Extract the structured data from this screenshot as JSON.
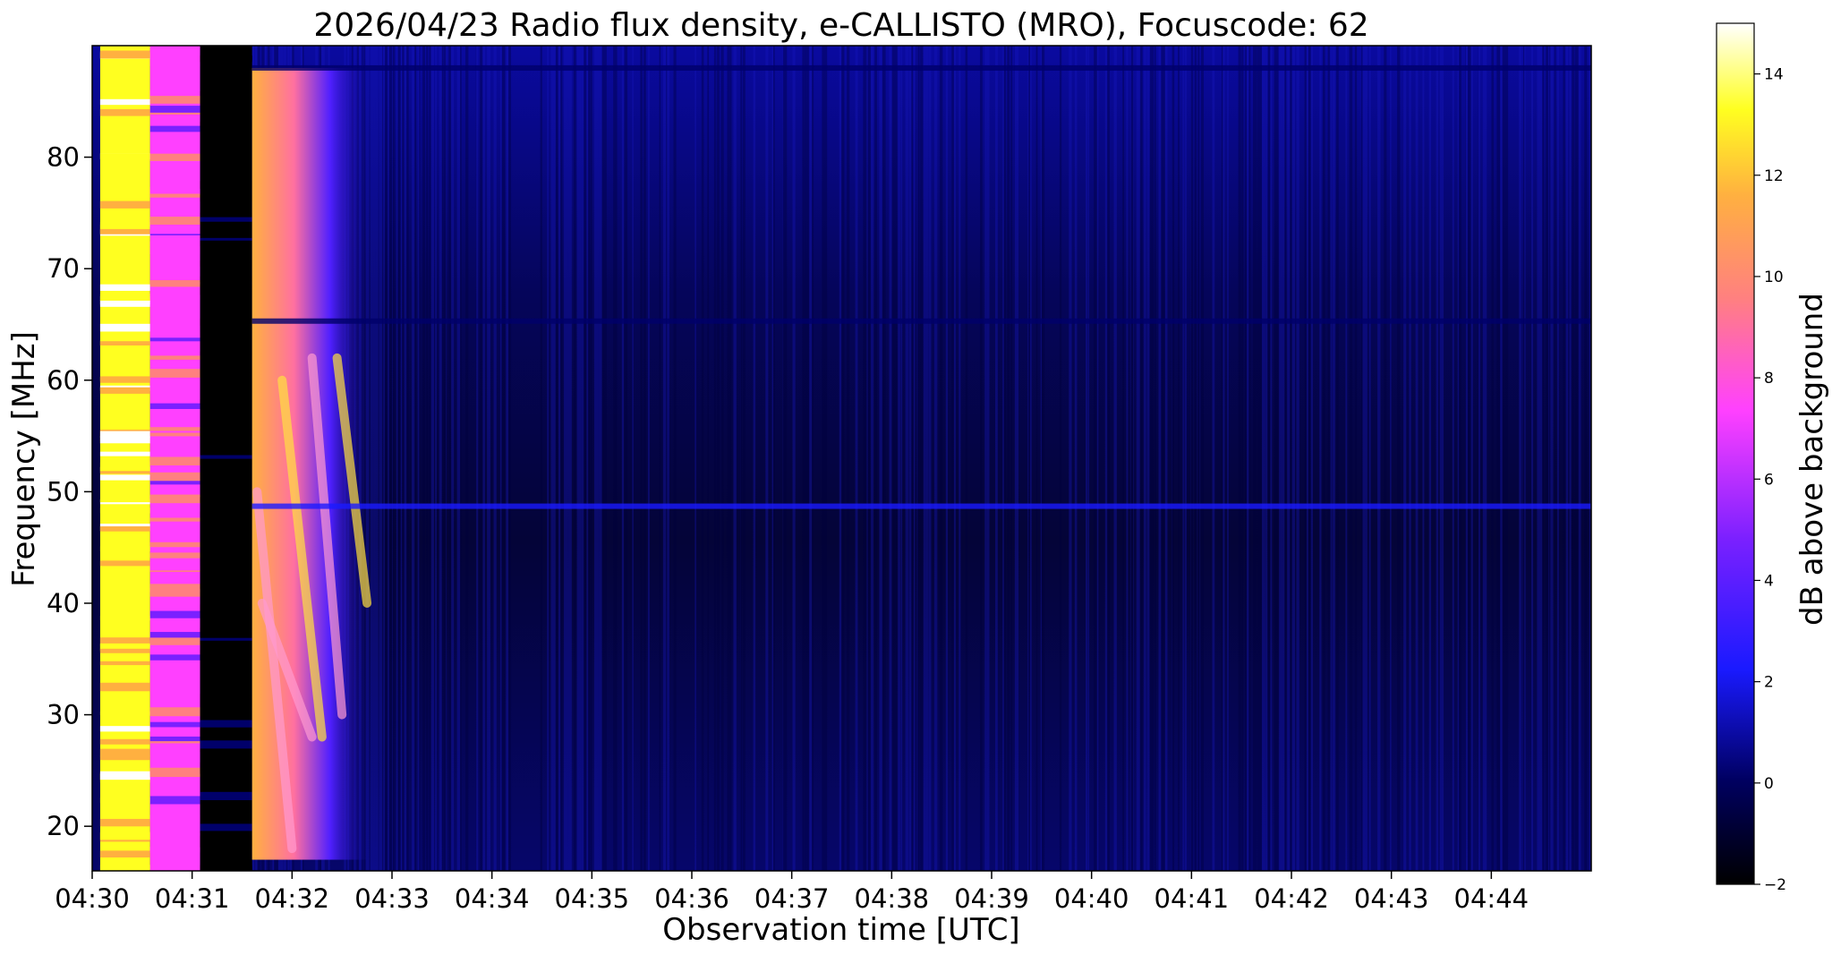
{
  "chart_data": {
    "type": "heatmap",
    "title": "2026/04/23  Radio flux density, e-CALLISTO (MRO), Focuscode: 62",
    "xlabel": "Observation time [UTC]",
    "ylabel": "Frequency [MHz]",
    "x_ticks": [
      "04:30",
      "04:31",
      "04:32",
      "04:33",
      "04:34",
      "04:35",
      "04:36",
      "04:37",
      "04:38",
      "04:39",
      "04:40",
      "04:41",
      "04:42",
      "04:43",
      "04:44"
    ],
    "xlim_minutes": [
      0,
      15
    ],
    "y_ticks": [
      20,
      30,
      40,
      50,
      60,
      70,
      80
    ],
    "ylim": [
      16,
      90
    ],
    "colorbar": {
      "label": "dB above background",
      "ticks": [
        -2,
        0,
        2,
        4,
        6,
        8,
        10,
        12,
        14
      ],
      "range": [
        -2,
        15
      ],
      "colormap": "gnuplot2"
    },
    "features": [
      {
        "name": "calibration-hot",
        "t": [
          0.08,
          0.58
        ],
        "f": [
          16,
          90
        ],
        "db": 14
      },
      {
        "name": "calibration-warm",
        "t": [
          0.58,
          1.08
        ],
        "f": [
          16,
          90
        ],
        "db": 8
      },
      {
        "name": "calibration-cold",
        "t": [
          1.08,
          1.6
        ],
        "f": [
          16,
          90
        ],
        "db": -2
      },
      {
        "name": "type-III-burst-group",
        "t": [
          1.6,
          2.8
        ],
        "f": [
          17,
          88
        ],
        "db": 12
      },
      {
        "name": "interference-line-65MHz",
        "f": 65.3,
        "db": 1
      },
      {
        "name": "interference-line-48.7MHz",
        "f": 48.7,
        "db": 1.5
      },
      {
        "name": "interference-line-88MHz",
        "f": 88,
        "db": 1
      }
    ]
  }
}
